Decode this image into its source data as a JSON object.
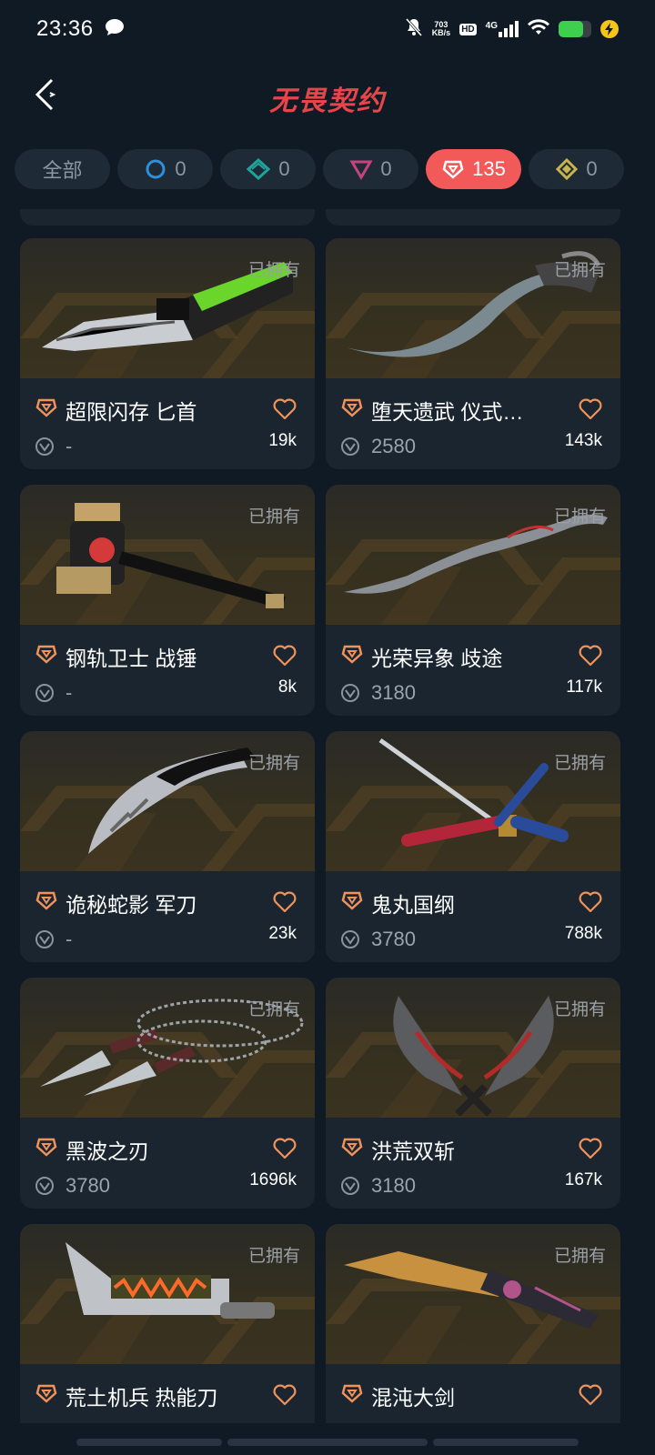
{
  "status_bar": {
    "time": "23:36",
    "net_speed_value": "703",
    "net_speed_unit": "KB/s",
    "hd_label": "HD",
    "signal_label": "4G",
    "battery_level": 0.75
  },
  "header": {
    "title": "无畏契约"
  },
  "filters": [
    {
      "label": "全部",
      "icon": "none",
      "count": "",
      "active": false
    },
    {
      "label": "",
      "icon": "select-tier-icon",
      "count": "0",
      "color": "#2f8fd8",
      "active": false
    },
    {
      "label": "",
      "icon": "deluxe-tier-icon",
      "count": "0",
      "color": "#1fa39a",
      "active": false
    },
    {
      "label": "",
      "icon": "premium-tier-icon",
      "count": "0",
      "color": "#c2457f",
      "active": false
    },
    {
      "label": "",
      "icon": "exclusive-tier-icon",
      "count": "135",
      "color": "#ffffff",
      "active": true
    },
    {
      "label": "",
      "icon": "ultra-tier-icon",
      "count": "0",
      "color": "#c8b44c",
      "active": false
    }
  ],
  "owned_label": "已拥有",
  "cards": [
    {
      "name": "超限闪存 匕首",
      "price": "-",
      "likes": "19k",
      "owned": true,
      "weapon_icon": "knife-icon"
    },
    {
      "name": "堕天遗武 仪式…",
      "price": "2580",
      "likes": "143k",
      "owned": true,
      "weapon_icon": "curved-blade-icon"
    },
    {
      "name": "钢轨卫士 战锤",
      "price": "-",
      "likes": "8k",
      "owned": true,
      "weapon_icon": "warhammer-icon"
    },
    {
      "name": "光荣异象 歧途",
      "price": "3180",
      "likes": "117k",
      "owned": true,
      "weapon_icon": "wavy-blade-icon"
    },
    {
      "name": "诡秘蛇影 军刀",
      "price": "-",
      "likes": "23k",
      "owned": true,
      "weapon_icon": "claw-blade-icon"
    },
    {
      "name": "鬼丸国纲",
      "price": "3780",
      "likes": "788k",
      "owned": true,
      "weapon_icon": "katana-icon"
    },
    {
      "name": "黑波之刃",
      "price": "3780",
      "likes": "1696k",
      "owned": true,
      "weapon_icon": "kunai-chain-icon"
    },
    {
      "name": "洪荒双斩",
      "price": "3180",
      "likes": "167k",
      "owned": true,
      "weapon_icon": "dual-blades-icon"
    },
    {
      "name": "荒土机兵 热能刀",
      "price": "",
      "likes": "",
      "owned": true,
      "weapon_icon": "thermal-blade-icon"
    },
    {
      "name": "混沌大剑",
      "price": "",
      "likes": "",
      "owned": true,
      "weapon_icon": "greatsword-icon"
    }
  ]
}
